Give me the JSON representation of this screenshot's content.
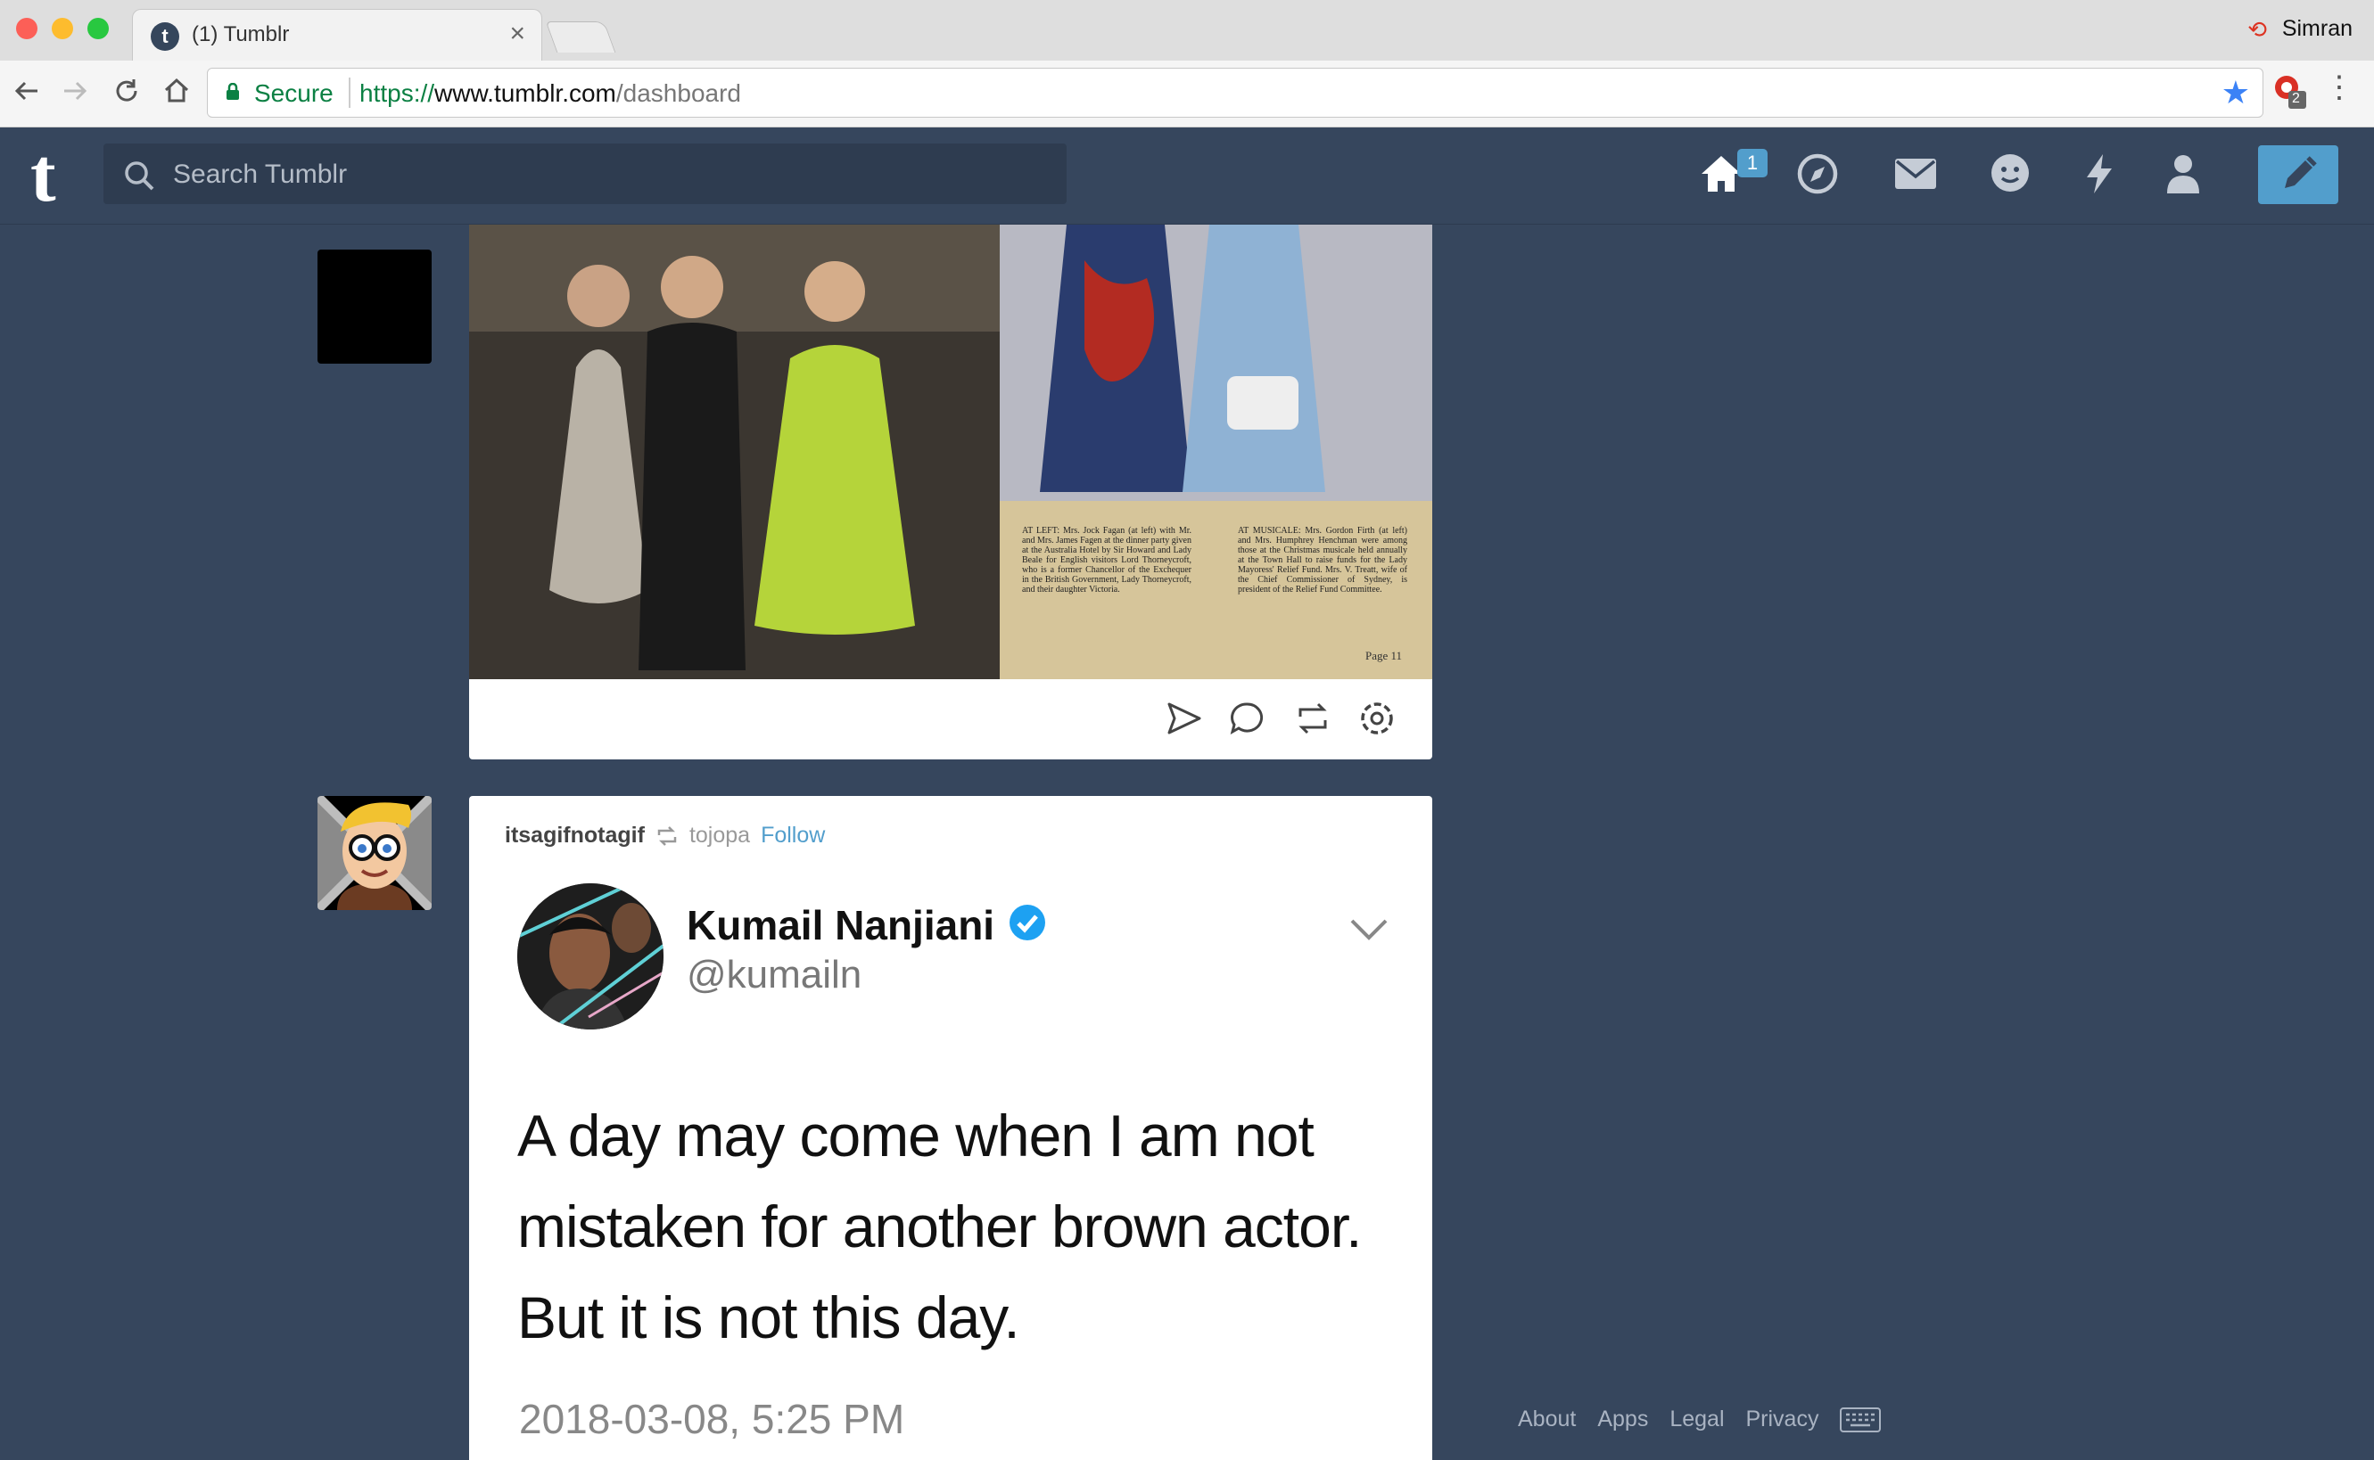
{
  "browser": {
    "tab_title": "(1) Tumblr",
    "tab_close": "×",
    "profile_name": "Simran",
    "secure_label": "Secure",
    "url_scheme": "https://",
    "url_host": "www.tumblr.com",
    "url_path": "/dashboard",
    "extension_badge": "2"
  },
  "tumblr": {
    "logo": "t",
    "search_placeholder": "Search Tumblr",
    "home_badge": "1",
    "accent_color": "#529ecc",
    "background_color": "#36465d",
    "nav_icons": [
      "home-icon",
      "explore-icon",
      "inbox-icon",
      "messaging-icon",
      "activity-icon",
      "account-icon",
      "compose-icon"
    ]
  },
  "post1": {
    "caption_left": "AT LEFT: Mrs. Jock Fagan (at left) with Mr. and Mrs. James Fagen at the dinner party given at the Australia Hotel by Sir Howard and Lady Beale for English visitors Lord Thorneycroft, who is a former Chancellor of the Exchequer in the British Government, Lady Thorneycroft, and their daughter Victoria.",
    "caption_right": "AT MUSICALE: Mrs. Gordon Firth (at left) and Mrs. Humphrey Henchman were among those at the Christmas musicale held annually at the Town Hall to raise funds for the Lady Mayoress' Relief Fund. Mrs. V. Treatt, wife of the Chief Commissioner of Sydney, is president of the Relief Fund Committee.",
    "page_label": "Page 11",
    "actions": [
      "share-icon",
      "reply-icon",
      "reblog-icon",
      "settings-icon"
    ]
  },
  "post2": {
    "blog_name": "itsagifnotagif",
    "reblogged_from": "tojopa",
    "follow_label": "Follow",
    "tweet": {
      "name": "Kumail Nanjiani",
      "handle": "@kumailn",
      "text_lines": [
        "A day may come when I am not",
        "mistaken for another brown actor.",
        "But it is not this day."
      ],
      "date": "2018-03-08, 5:25 PM"
    }
  },
  "footer": {
    "links": [
      "About",
      "Apps",
      "Legal",
      "Privacy"
    ]
  }
}
